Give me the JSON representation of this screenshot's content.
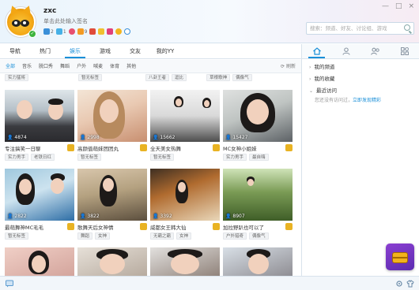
{
  "user": {
    "name": "zxc",
    "signature": "单击此处输入签名",
    "level_values": [
      "2",
      "1",
      "9"
    ]
  },
  "window_controls": [
    "—",
    "□",
    "×"
  ],
  "search": {
    "placeholder": "搜索：频道、好友、讨论组、游戏"
  },
  "main_tabs": [
    {
      "label": "导航"
    },
    {
      "label": "热门"
    },
    {
      "label": "娱乐"
    },
    {
      "label": "游戏"
    },
    {
      "label": "交友"
    },
    {
      "label": "我的YY"
    }
  ],
  "sub_tabs": [
    {
      "label": "全部"
    },
    {
      "label": "音乐"
    },
    {
      "label": "脱口秀"
    },
    {
      "label": "舞蹈"
    },
    {
      "label": "户外"
    },
    {
      "label": "喊麦"
    },
    {
      "label": "体育"
    },
    {
      "label": "其他"
    }
  ],
  "refresh_label": "刷新",
  "top_tags": [
    "实力猛将",
    "暂无标签",
    "八卦王者",
    "逗比",
    "草根歌神",
    "偶像气"
  ],
  "cards": [
    {
      "views": "4874",
      "title": "专注搞笑一日聊",
      "tags": [
        "实力男手",
        "老铁日红"
      ]
    },
    {
      "views": "2998",
      "title": "高颜值萌妹团团丸",
      "tags": [
        "暂无标签"
      ]
    },
    {
      "views": "15662",
      "title": "全天美女热舞",
      "tags": [
        "暂无标签"
      ]
    },
    {
      "views": "15427",
      "title": "MC女神小姐妹",
      "tags": [
        "实力男手",
        "最自嗨"
      ]
    },
    {
      "views": "2822",
      "title": "最萌舞神MC毛毛",
      "tags": [
        "暂无标签"
      ]
    },
    {
      "views": "3822",
      "title": "歌舞天后女神情",
      "tags": [
        "舞蹈",
        "女神"
      ]
    },
    {
      "views": "3392",
      "title": "威都女王韩大仙",
      "tags": [
        "无霸之霸",
        "女神"
      ]
    },
    {
      "views": "8907",
      "title": "加拉野趴也可以了",
      "tags": [
        "户外猎奇",
        "偶像气"
      ]
    },
    {
      "views": "",
      "title": "",
      "tags": []
    },
    {
      "views": "",
      "title": "",
      "tags": []
    },
    {
      "views": "",
      "title": "",
      "tags": []
    },
    {
      "views": "",
      "title": "",
      "tags": []
    }
  ],
  "right_panel": {
    "sections": [
      {
        "label": "我的频道"
      },
      {
        "label": "我的收藏"
      },
      {
        "label": "最近访问"
      }
    ],
    "empty_text": "您还没有访问过，",
    "empty_link": "立即发现精彩"
  }
}
